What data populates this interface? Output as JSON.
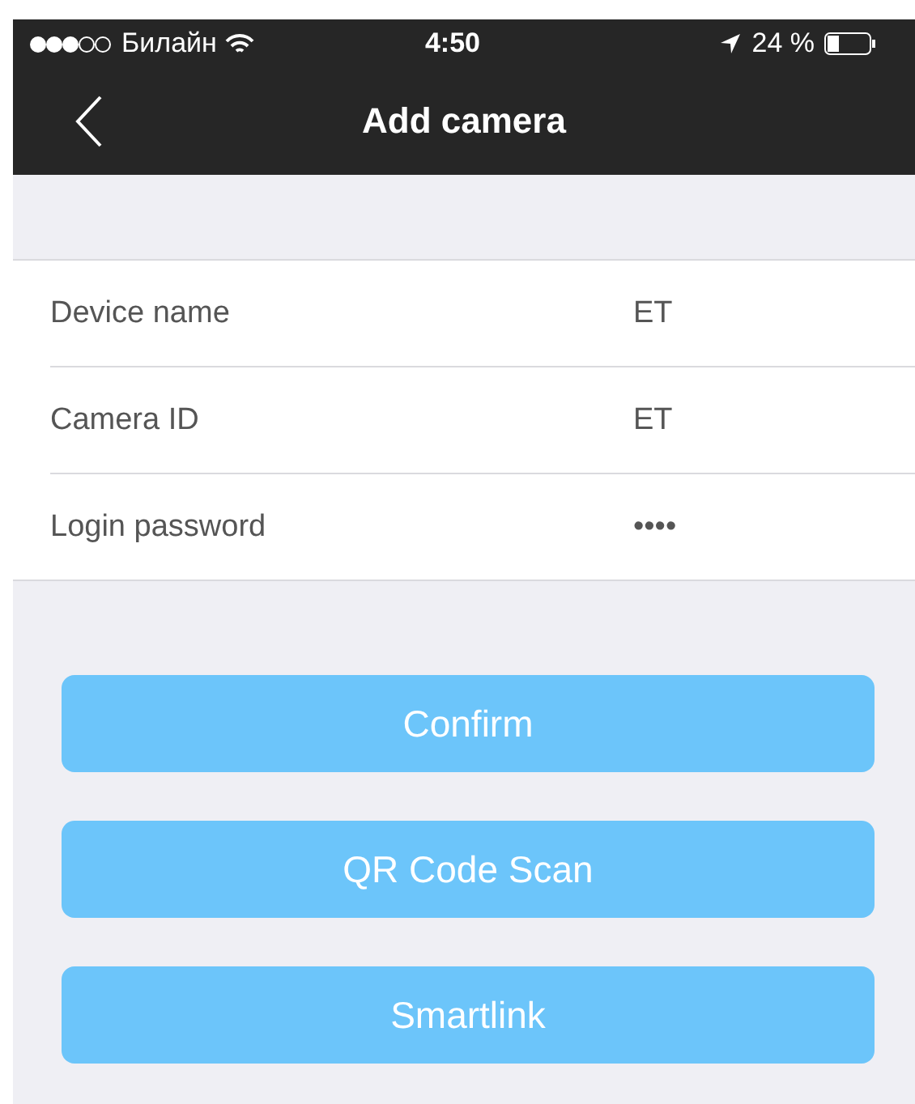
{
  "status_bar": {
    "carrier": "Билайн",
    "time": "4:50",
    "battery": "24 %"
  },
  "nav_bar": {
    "title": "Add camera"
  },
  "fields": [
    {
      "label": "Device name",
      "value": "ET"
    },
    {
      "label": "Camera ID",
      "value": "ET"
    },
    {
      "label": "Login password",
      "value": "••••"
    }
  ],
  "buttons": [
    "Confirm",
    "QR Code Scan",
    "Smartlink"
  ]
}
